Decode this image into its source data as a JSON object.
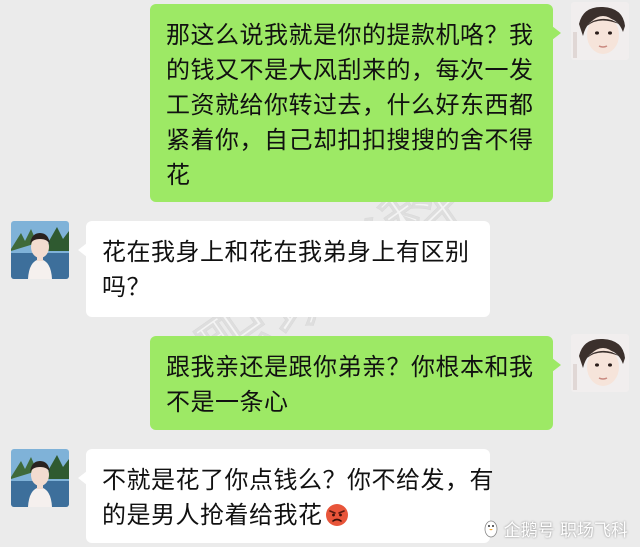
{
  "messages": [
    {
      "sender": "me",
      "lines": [
        "那这么说我就是你的提款机咯？我",
        "的钱又不是大风刮来的，每次一发",
        "工资就给你转过去，什么好东西都",
        "紧着你，自己却扣扣搜搜的舍不得",
        "花"
      ]
    },
    {
      "sender": "them",
      "lines": [
        "花在我身上和花在我弟身上有区别",
        "吗？"
      ]
    },
    {
      "sender": "me",
      "lines": [
        "跟我亲还是跟你弟亲？你根本和我",
        "不是一条心"
      ]
    },
    {
      "sender": "them",
      "lines": [
        "不就是花了你点钱么？你不给发，有",
        "的是男人抢着给我花"
      ]
    }
  ],
  "watermark": {
    "center_text": "职场飞科",
    "bottom_text": "企鹅号 职场飞科"
  },
  "colors": {
    "background": "#ebebeb",
    "me_bubble": "#9de965",
    "them_bubble": "#ffffff"
  },
  "icons": {
    "angry_emoji": "angry-face-icon"
  }
}
